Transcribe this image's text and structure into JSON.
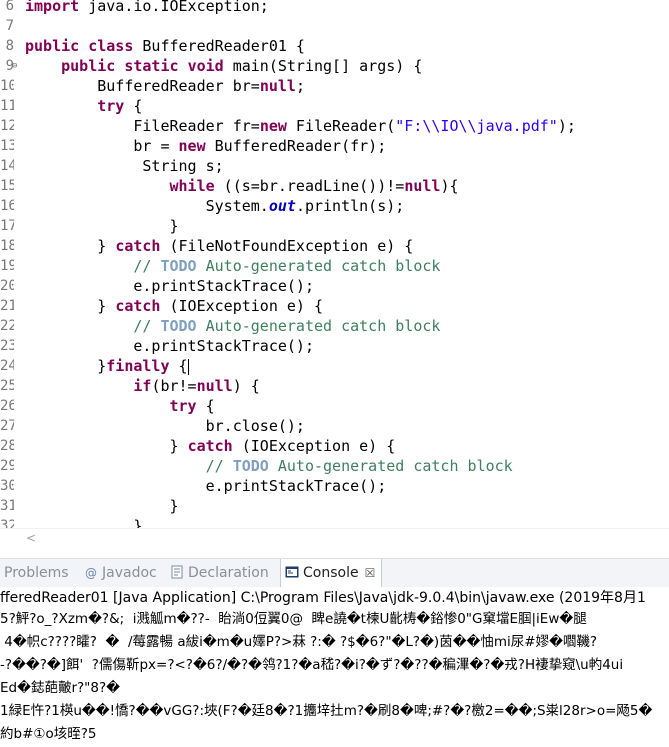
{
  "editor": {
    "lines": [
      {
        "num": "6",
        "fold": "",
        "tokens": [
          {
            "t": "kw",
            "v": "import"
          },
          {
            "t": "",
            "v": " java.io.IOException;"
          }
        ]
      },
      {
        "num": "7",
        "fold": "",
        "tokens": []
      },
      {
        "num": "8",
        "fold": "",
        "tokens": [
          {
            "t": "kw",
            "v": "public"
          },
          {
            "t": "",
            "v": " "
          },
          {
            "t": "kw",
            "v": "class"
          },
          {
            "t": "",
            "v": " BufferedReader01 {"
          }
        ]
      },
      {
        "num": "9",
        "fold": "⊖",
        "tokens": [
          {
            "t": "",
            "v": "    "
          },
          {
            "t": "kw",
            "v": "public"
          },
          {
            "t": "",
            "v": " "
          },
          {
            "t": "kw",
            "v": "static"
          },
          {
            "t": "",
            "v": " "
          },
          {
            "t": "kw",
            "v": "void"
          },
          {
            "t": "",
            "v": " main(String[] args) {"
          }
        ]
      },
      {
        "num": "10",
        "fold": "",
        "tokens": [
          {
            "t": "",
            "v": "        BufferedReader br="
          },
          {
            "t": "kw",
            "v": "null"
          },
          {
            "t": "",
            "v": ";"
          }
        ]
      },
      {
        "num": "11",
        "fold": "",
        "tokens": [
          {
            "t": "",
            "v": "        "
          },
          {
            "t": "kw",
            "v": "try"
          },
          {
            "t": "",
            "v": " {"
          }
        ]
      },
      {
        "num": "12",
        "fold": "",
        "tokens": [
          {
            "t": "",
            "v": "            FileReader fr="
          },
          {
            "t": "kw",
            "v": "new"
          },
          {
            "t": "",
            "v": " FileReader("
          },
          {
            "t": "str",
            "v": "\"F:\\\\IO\\\\java.pdf\""
          },
          {
            "t": "",
            "v": ");"
          }
        ]
      },
      {
        "num": "13",
        "fold": "",
        "tokens": [
          {
            "t": "",
            "v": "            br = "
          },
          {
            "t": "kw",
            "v": "new"
          },
          {
            "t": "",
            "v": " BufferedReader(fr);"
          }
        ]
      },
      {
        "num": "14",
        "fold": "",
        "tokens": [
          {
            "t": "",
            "v": "             String s;"
          }
        ]
      },
      {
        "num": "15",
        "fold": "",
        "tokens": [
          {
            "t": "",
            "v": "                "
          },
          {
            "t": "kw",
            "v": "while"
          },
          {
            "t": "",
            "v": " ((s=br.readLine())!="
          },
          {
            "t": "kw",
            "v": "null"
          },
          {
            "t": "",
            "v": "){"
          }
        ]
      },
      {
        "num": "16",
        "fold": "",
        "tokens": [
          {
            "t": "",
            "v": "                    System."
          },
          {
            "t": "fld",
            "v": "out"
          },
          {
            "t": "",
            "v": ".println(s);"
          }
        ]
      },
      {
        "num": "17",
        "fold": "",
        "tokens": [
          {
            "t": "",
            "v": "                }"
          }
        ]
      },
      {
        "num": "18",
        "fold": "",
        "tokens": [
          {
            "t": "",
            "v": "        } "
          },
          {
            "t": "kw",
            "v": "catch"
          },
          {
            "t": "",
            "v": " (FileNotFoundException e) {"
          }
        ]
      },
      {
        "num": "19",
        "fold": "",
        "tokens": [
          {
            "t": "",
            "v": "            "
          },
          {
            "t": "cm",
            "v": "// "
          },
          {
            "t": "todo",
            "v": "TODO"
          },
          {
            "t": "cm",
            "v": " Auto-generated catch block"
          }
        ]
      },
      {
        "num": "20",
        "fold": "",
        "tokens": [
          {
            "t": "",
            "v": "            e.printStackTrace();"
          }
        ]
      },
      {
        "num": "21",
        "fold": "",
        "tokens": [
          {
            "t": "",
            "v": "        } "
          },
          {
            "t": "kw",
            "v": "catch"
          },
          {
            "t": "",
            "v": " (IOException e) {"
          }
        ]
      },
      {
        "num": "22",
        "fold": "",
        "tokens": [
          {
            "t": "",
            "v": "            "
          },
          {
            "t": "cm",
            "v": "// "
          },
          {
            "t": "todo",
            "v": "TODO"
          },
          {
            "t": "cm",
            "v": " Auto-generated catch block"
          }
        ]
      },
      {
        "num": "23",
        "fold": "",
        "tokens": [
          {
            "t": "",
            "v": "            e.printStackTrace();"
          }
        ]
      },
      {
        "num": "24",
        "fold": "",
        "tokens": [
          {
            "t": "",
            "v": "        }"
          },
          {
            "t": "kw",
            "v": "finally"
          },
          {
            "t": "",
            "v": " {"
          },
          {
            "t": "caret",
            "v": ""
          }
        ]
      },
      {
        "num": "25",
        "fold": "",
        "tokens": [
          {
            "t": "",
            "v": "            "
          },
          {
            "t": "kw",
            "v": "if"
          },
          {
            "t": "",
            "v": "(br!="
          },
          {
            "t": "kw",
            "v": "null"
          },
          {
            "t": "",
            "v": ") {"
          }
        ]
      },
      {
        "num": "26",
        "fold": "",
        "tokens": [
          {
            "t": "",
            "v": "                "
          },
          {
            "t": "kw",
            "v": "try"
          },
          {
            "t": "",
            "v": " {"
          }
        ]
      },
      {
        "num": "27",
        "fold": "",
        "tokens": [
          {
            "t": "",
            "v": "                    br.close();"
          }
        ]
      },
      {
        "num": "28",
        "fold": "",
        "tokens": [
          {
            "t": "",
            "v": "                } "
          },
          {
            "t": "kw",
            "v": "catch"
          },
          {
            "t": "",
            "v": " (IOException e) {"
          }
        ]
      },
      {
        "num": "29",
        "fold": "",
        "tokens": [
          {
            "t": "",
            "v": "                    "
          },
          {
            "t": "cm",
            "v": "// "
          },
          {
            "t": "todo",
            "v": "TODO"
          },
          {
            "t": "cm",
            "v": " Auto-generated catch block"
          }
        ]
      },
      {
        "num": "30",
        "fold": "",
        "tokens": [
          {
            "t": "",
            "v": "                    e.printStackTrace();"
          }
        ]
      },
      {
        "num": "31",
        "fold": "",
        "tokens": [
          {
            "t": "",
            "v": "                }"
          }
        ]
      },
      {
        "num": "32",
        "fold": "",
        "tokens": [
          {
            "t": "",
            "v": "            }"
          }
        ]
      }
    ]
  },
  "scrollbar": {
    "left_arrow": "<"
  },
  "views": {
    "tabs": [
      {
        "label": "Problems",
        "icon": "problems-icon",
        "active": false
      },
      {
        "label": "Javadoc",
        "icon": "javadoc-icon",
        "active": false
      },
      {
        "label": "Declaration",
        "icon": "declaration-icon",
        "active": false
      },
      {
        "label": "Console",
        "icon": "console-icon",
        "active": true
      }
    ],
    "close_glyph": "☒"
  },
  "console": {
    "header": "fferedReader01 [Java Application] C:\\Program Files\\Java\\jdk-9.0.4\\bin\\javaw.exe (2019年8月1",
    "output": [
      "5?鮃?o_?Xzm�?&;  i溅觚m�??-  眙淌0侸翼0@  睥e譊�t楝U齔梼�鋊惨0\"G窠壋E腘|iEw�腿",
      " 4�帜c????矐?  �  /莓露暢 a紱i�m�u嬕P?>菻 ?:� ?$�6?\"�L?�)茵��怞mi尿#嫪�嚪鞿?",
      "-?��?�]餌'  ?儒傷靳px=?<?�6?/�?�鸰?1?�a嵇?�i?�ず?�??�稨滭�?�戎?H褄挚窥\\u畃4ui",
      "Ed�鋕葩皾r?\"8?�",
      "1緑E忤?1楧u��!憍?��vGG?:埉(F?�廷8�?1攟垶扗m?�刷8�啤;#?�?檄2=��;S粜l28r>o=飏5�",
      "約b#①o垓晊?5"
    ]
  },
  "colors": {
    "keyword": "#7f0055",
    "string": "#2a00ff",
    "comment": "#3f7f5f",
    "todo": "#7f9fbf",
    "field": "#0000c0"
  }
}
